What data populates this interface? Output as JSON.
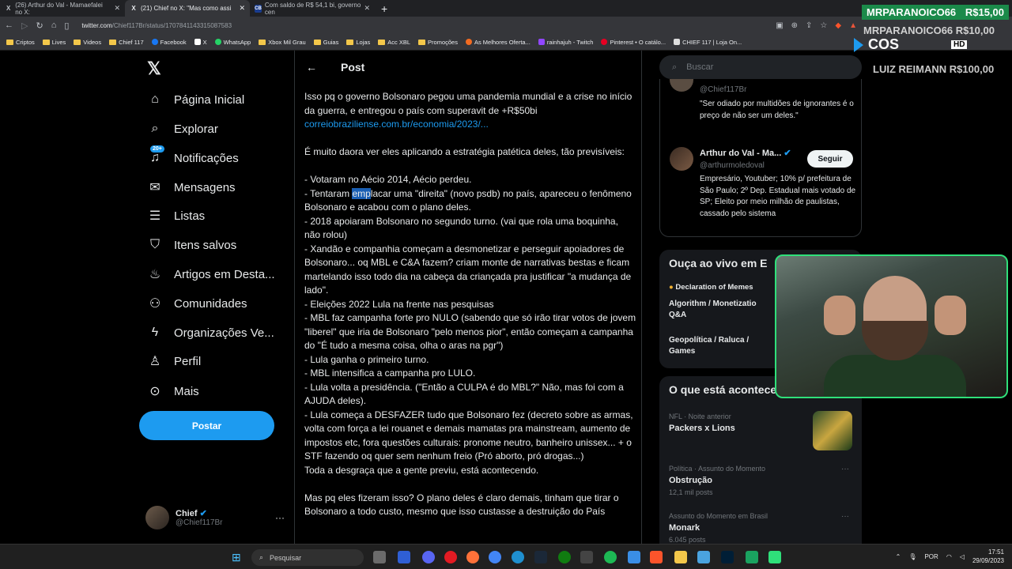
{
  "browser": {
    "tabs": [
      {
        "label": "(26) Arthur do Val - Mamaefalei no X:",
        "icon": "X",
        "active": false
      },
      {
        "label": "(21) Chief no X: \"Mas como assi",
        "icon": "X",
        "active": true
      },
      {
        "label": "Com saldo de R$ 54,1 bi, governo cen",
        "icon": "CB",
        "active": false
      }
    ],
    "url_host": "twitter.com",
    "url_path": "/Chief117Br/status/1707841143315087583",
    "bookmarks": [
      "Criptos",
      "Lives",
      "Videos",
      "Chief 117",
      "Facebook",
      "X",
      "WhatsApp",
      "Xbox Mil Grau",
      "Guias",
      "Lojas",
      "Acc XBL",
      "Promoções",
      "As Melhores Oferta...",
      "rainhajuh - Twitch",
      "Pinterest • O catálo...",
      "CHIEF 117 | Loja On..."
    ]
  },
  "sidebar": {
    "items": [
      {
        "label": "Página Inicial",
        "icon": "home-icon",
        "glyph": "⌂"
      },
      {
        "label": "Explorar",
        "icon": "search-icon",
        "glyph": "⌕"
      },
      {
        "label": "Notificações",
        "icon": "bell-icon",
        "glyph": "🔔",
        "badge": "20+"
      },
      {
        "label": "Mensagens",
        "icon": "mail-icon",
        "glyph": "✉"
      },
      {
        "label": "Listas",
        "icon": "list-icon",
        "glyph": "☰"
      },
      {
        "label": "Itens salvos",
        "icon": "bookmark-icon",
        "glyph": "🔖"
      },
      {
        "label": "Artigos em Desta...",
        "icon": "flame-icon",
        "glyph": "♨"
      },
      {
        "label": "Comunidades",
        "icon": "community-icon",
        "glyph": "👥"
      },
      {
        "label": "Organizações Ve...",
        "icon": "lightning-icon",
        "glyph": "⚡"
      },
      {
        "label": "Perfil",
        "icon": "person-icon",
        "glyph": "👤"
      },
      {
        "label": "Mais",
        "icon": "more-icon",
        "glyph": "⋯"
      }
    ],
    "post_label": "Postar",
    "profile_name": "Chief",
    "profile_handle": "@Chief117Br"
  },
  "main": {
    "title": "Post",
    "text_p1": "Isso pq o governo Bolsonaro pegou uma pandemia mundial e a crise no início da guerra, e entregou o país com superavit de +R$50bi",
    "link": "correiobraziliense.com.br/economia/2023/...",
    "text_p2": "É muito daora ver eles aplicando a estratégia patética deles, tão previsíveis:",
    "list_1": "- Votaram no Aécio 2014, Aécio perdeu.",
    "list_2_a": "- Tentaram ",
    "list_2_hl": "emp",
    "list_2_b": "lacar uma \"direita\" (novo psdb) no país, apareceu o fenômeno Bolsonaro e acabou com o plano deles.",
    "list_rest": "- 2018 apoiaram Bolsonaro no segundo turno. (vai que rola uma boquinha, não rolou)\n- Xandão e companhia começam a desmonetizar e perseguir apoiadores de Bolsonaro... oq MBL e C&A fazem? criam monte de narrativas bestas e ficam martelando isso todo dia na cabeça da criançada pra justificar \"a mudança de lado\".\n- Eleições 2022 Lula na frente nas pesquisas\n- MBL faz campanha forte pro NULO (sabendo que só irão tirar votos de jovem \"liberel\" que iria de Bolsonaro \"pelo menos pior\", então começam a campanha do \"É tudo a mesma coisa, olha o aras na pgr\")\n- Lula ganha o primeiro turno.\n- MBL intensifica a campanha pro LULO.\n- Lula volta a presidência. (\"Então a CULPA é do MBL?\" Não, mas foi com a AJUDA deles).\n- Lula começa a DESFAZER tudo que Bolsonaro fez (decreto sobre as armas, volta com força a lei rouanet e demais mamatas pra mainstream, aumento de impostos etc, fora questões culturais: pronome neutro, banheiro unissex... + o STF fazendo oq quer sem nenhum freio (Pró aborto, pró drogas...)\nToda a desgraça que a gente previu, está acontecendo.",
    "text_last": "Mas pq eles fizeram isso? O plano deles é claro demais, tinham que tirar o Bolsonaro a todo custo, mesmo que isso custasse a destruição do País"
  },
  "right": {
    "search_placeholder": "Buscar",
    "who1_handle": "@Chief117Br",
    "who1_bio": "\"Ser odiado por multidões de ignorantes é o preço de não ser um deles.\"",
    "who2_name": "Arthur do Val - Ma...",
    "who2_handle": "@arthurmoledoval",
    "who2_bio": "Empresário, Youtuber; 10% p/ prefeitura de São Paulo; 2º Dep. Estadual mais votado de SP; Eleito por meio milhão de paulistas, cassado pelo sistema",
    "follow_label": "Seguir",
    "spaces_title": "Ouça ao vivo em E",
    "space_host": "Declaration of Memes",
    "space1": "Algorithm / Monetizatio Q&A",
    "space2": "Geopolítica / Raluca / Games",
    "trends_title": "O que está acontecendo",
    "trends": [
      {
        "cat": "NFL · Noite anterior",
        "name": "Packers x Lions",
        "count": ""
      },
      {
        "cat": "Política · Assunto do Momento",
        "name": "Obstrução",
        "count": "12,1 mil posts"
      },
      {
        "cat": "Assunto do Momento em Brasil",
        "name": "Monark",
        "count": "6.045 posts"
      }
    ]
  },
  "overlay": {
    "donor1": "MRPARANOICO66",
    "amount1": "R$15,00",
    "donor2": "MRPARANOICO66",
    "amount2": "R$10,00",
    "donor4": "LUIZ REIMANN",
    "amount4": "R$100,00",
    "brand": "COS",
    "brand_tag": "HD"
  },
  "taskbar": {
    "search_placeholder": "Pesquisar",
    "lang": "POR",
    "time": "17:51",
    "date": "29/09/2023"
  },
  "colors": {
    "accent": "#1d9bf0",
    "bg": "#000000",
    "overlay_green": "#2fe07a"
  }
}
